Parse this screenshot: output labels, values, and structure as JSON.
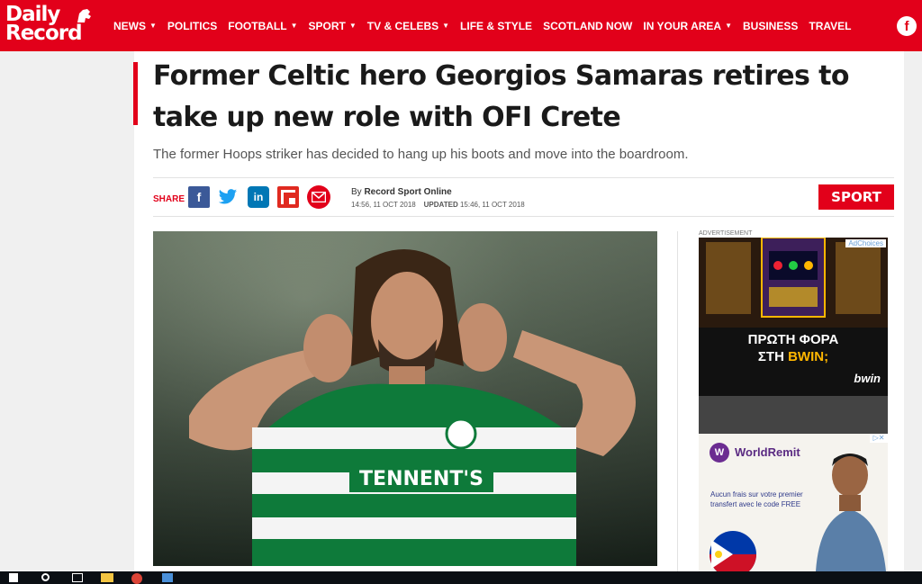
{
  "header": {
    "logo_line1": "Daily",
    "logo_line2": "Record",
    "nav": [
      {
        "label": "NEWS",
        "dropdown": true
      },
      {
        "label": "POLITICS",
        "dropdown": false
      },
      {
        "label": "FOOTBALL",
        "dropdown": true
      },
      {
        "label": "SPORT",
        "dropdown": true
      },
      {
        "label": "TV & CELEBS",
        "dropdown": true
      },
      {
        "label": "LIFE & STYLE",
        "dropdown": false
      },
      {
        "label": "SCOTLAND NOW",
        "dropdown": false
      },
      {
        "label": "IN YOUR AREA",
        "dropdown": true
      },
      {
        "label": "BUSINESS",
        "dropdown": false
      },
      {
        "label": "TRAVEL",
        "dropdown": false
      }
    ],
    "facebook_icon_glyph": "f",
    "brand_color": "#e2001a"
  },
  "article": {
    "headline": "Former Celtic hero Georgios Samaras retires to take up new role with OFI Crete",
    "standfirst": "The former Hoops striker has decided to hang up his boots and move into the boardroom.",
    "share_label": "SHARE",
    "share_icons": [
      "facebook-icon",
      "twitter-icon",
      "linkedin-icon",
      "flipboard-icon",
      "email-icon"
    ],
    "by_prefix": "By",
    "author": "Record Sport Online",
    "published": "14:56, 11 OCT 2018",
    "updated_label": "UPDATED",
    "updated": "15:46, 11 OCT 2018",
    "section_badge": "SPORT",
    "hero_caption_text": "TENNENT'S"
  },
  "sidebar": {
    "advertisement_label": "ADVERTISEMENT",
    "ad1": {
      "choices": "AdChoices",
      "line1": "ΠΡΩΤΗ ΦΟΡΑ",
      "line2_prefix": "ΣΤΗ ",
      "line2_highlight": "BWIN;",
      "brand": "bwin"
    },
    "ad2": {
      "brand": "WorldRemit",
      "text": "Aucun frais sur votre premier transfert avec le code FREE"
    }
  }
}
